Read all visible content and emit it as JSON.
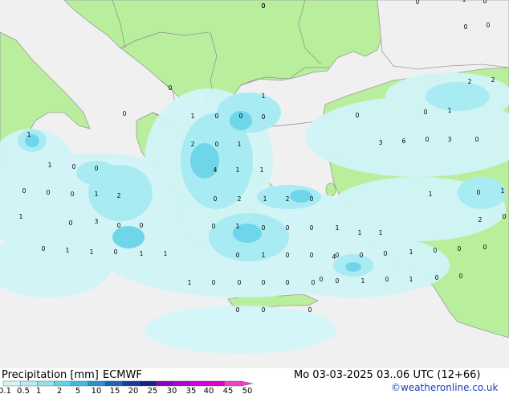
{
  "footer": {
    "title": "Precipitation [mm]",
    "model": "ECMWF",
    "datetime": "Mo 03-03-2025 03..06 UTC (12+66)",
    "credit": "©weatheronline.co.uk"
  },
  "legend": {
    "labels": [
      "0.1",
      "0.5",
      "1",
      "2",
      "5",
      "10",
      "15",
      "20",
      "25",
      "30",
      "35",
      "40",
      "45",
      "50"
    ],
    "colors": [
      "#d2f5f8",
      "#b4eef4",
      "#8fe3ee",
      "#5fd3e6",
      "#3fbde0",
      "#2a8fd4",
      "#2060c4",
      "#1a3aa8",
      "#12248a",
      "#8a00c8",
      "#b000d8",
      "#d000e0",
      "#e000c8",
      "#f040d0"
    ]
  },
  "colors": {
    "land": "#b9ef9c",
    "sea": "#f0f0f0",
    "border": "#8a8a8a",
    "coast": "#9a9a9a",
    "precip_light": "#d2f5f8",
    "precip_mid": "#a8ebf3",
    "precip_heavy": "#6fd6ea"
  },
  "station_values": [
    {
      "v": "0"
    },
    {
      "v": "0"
    },
    {
      "v": "1"
    },
    {
      "v": "0"
    },
    {
      "v": "0"
    },
    {
      "v": "0"
    },
    {
      "v": "0"
    },
    {
      "v": "2"
    },
    {
      "v": "2"
    },
    {
      "v": "0"
    },
    {
      "v": "1"
    },
    {
      "v": "0"
    },
    {
      "v": "0"
    },
    {
      "v": "1"
    },
    {
      "v": "0"
    },
    {
      "v": "0"
    },
    {
      "v": "0"
    },
    {
      "v": "1"
    },
    {
      "v": "0"
    },
    {
      "v": "3"
    },
    {
      "v": "0"
    },
    {
      "v": "6"
    },
    {
      "v": "3"
    },
    {
      "v": "1"
    },
    {
      "v": "2"
    },
    {
      "v": "0"
    },
    {
      "v": "1"
    },
    {
      "v": "1"
    },
    {
      "v": "4"
    },
    {
      "v": "1"
    },
    {
      "v": "1"
    },
    {
      "v": "0"
    },
    {
      "v": "0"
    },
    {
      "v": "0"
    },
    {
      "v": "0"
    },
    {
      "v": "2"
    },
    {
      "v": "1"
    },
    {
      "v": "0"
    },
    {
      "v": "0"
    },
    {
      "v": "2"
    },
    {
      "v": "1"
    },
    {
      "v": "2"
    },
    {
      "v": "0"
    },
    {
      "v": "1"
    },
    {
      "v": "0"
    },
    {
      "v": "1"
    },
    {
      "v": "1"
    },
    {
      "v": "0"
    },
    {
      "v": "3"
    },
    {
      "v": "0"
    },
    {
      "v": "0"
    },
    {
      "v": "0"
    },
    {
      "v": "1"
    },
    {
      "v": "0"
    },
    {
      "v": "0"
    },
    {
      "v": "0"
    },
    {
      "v": "1"
    },
    {
      "v": "0"
    },
    {
      "v": "1"
    },
    {
      "v": "1"
    },
    {
      "v": "0"
    },
    {
      "v": "1"
    },
    {
      "v": "1"
    },
    {
      "v": "0"
    },
    {
      "v": "1"
    },
    {
      "v": "0"
    },
    {
      "v": "0"
    },
    {
      "v": "0"
    },
    {
      "v": "0"
    },
    {
      "v": "0"
    },
    {
      "v": "1"
    },
    {
      "v": "0"
    },
    {
      "v": "0"
    },
    {
      "v": "0"
    },
    {
      "v": "1"
    },
    {
      "v": "0"
    },
    {
      "v": "0"
    },
    {
      "v": "0"
    },
    {
      "v": "0"
    },
    {
      "v": "0"
    },
    {
      "v": "0"
    },
    {
      "v": "1"
    },
    {
      "v": "0"
    },
    {
      "v": "1"
    },
    {
      "v": "0"
    },
    {
      "v": "0"
    },
    {
      "v": "0"
    },
    {
      "v": "0"
    },
    {
      "v": "1"
    },
    {
      "v": "1"
    },
    {
      "v": "2"
    },
    {
      "v": "0"
    },
    {
      "v": "4"
    },
    {
      "v": "0"
    },
    {
      "v": "0"
    },
    {
      "v": "0"
    }
  ]
}
